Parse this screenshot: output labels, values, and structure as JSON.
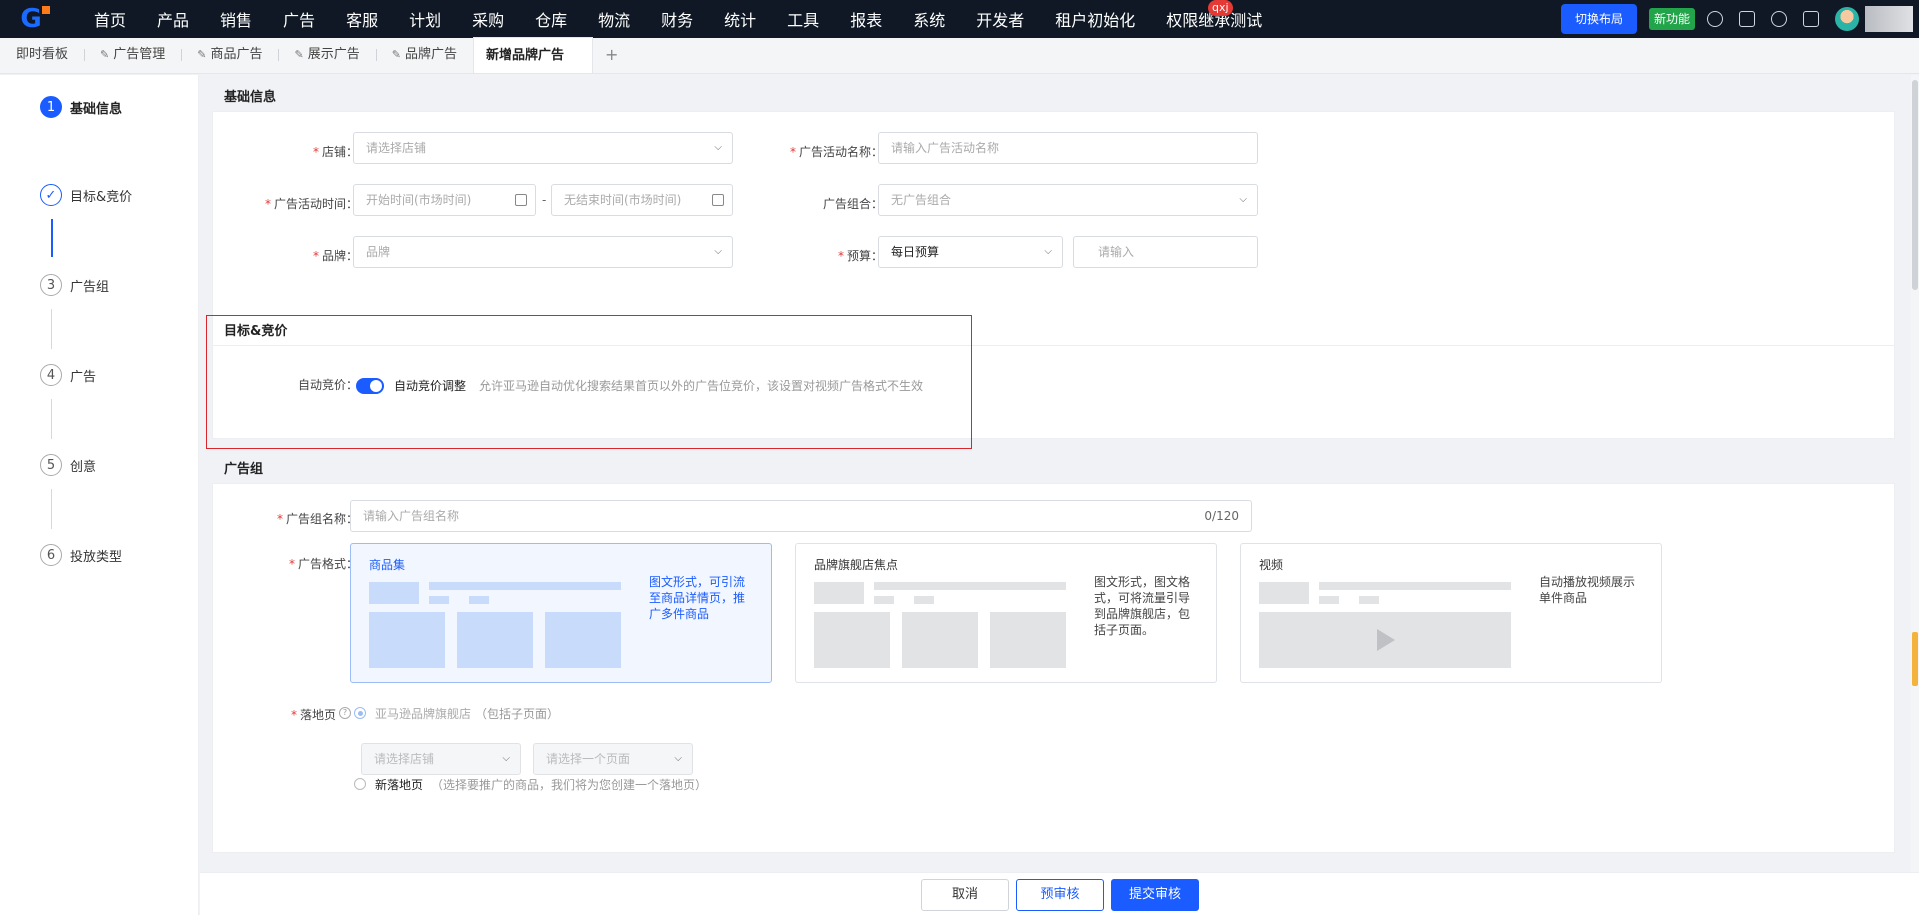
{
  "nav": {
    "menu": [
      "首页",
      "产品",
      "销售",
      "广告",
      "客服",
      "计划",
      "采购",
      "仓库",
      "物流",
      "财务",
      "统计",
      "工具",
      "报表",
      "系统",
      "开发者",
      "租户初始化",
      "权限继承测试"
    ],
    "badge": "qxj",
    "switch_label": "切换布局",
    "new_feature_label": "新功能"
  },
  "tabs": [
    "即时看板",
    "广告管理",
    "商品广告",
    "展示广告",
    "品牌广告",
    "新增品牌广告"
  ],
  "tab_add": "+",
  "steps": [
    {
      "num": "1",
      "label": "基础信息",
      "state": "active"
    },
    {
      "num": "✓",
      "label": "目标&竞价",
      "state": "done"
    },
    {
      "num": "3",
      "label": "广告组",
      "state": "todo"
    },
    {
      "num": "4",
      "label": "广告",
      "state": "todo"
    },
    {
      "num": "5",
      "label": "创意",
      "state": "todo"
    },
    {
      "num": "6",
      "label": "投放类型",
      "state": "todo"
    }
  ],
  "basic": {
    "title": "基础信息",
    "store_label": "店铺：",
    "store_placeholder": "请选择店铺",
    "campaign_name_label": "广告活动名称：",
    "campaign_name_placeholder": "请输入广告活动名称",
    "time_label": "广告活动时间：",
    "start_placeholder": "开始时间(市场时间)",
    "time_sep": "-",
    "end_placeholder": "无结束时间(市场时间)",
    "portfolio_label": "广告组合：",
    "portfolio_value": "无广告组合",
    "brand_label": "品牌：",
    "brand_placeholder": "品牌",
    "budget_label": "预算：",
    "budget_type": "每日预算",
    "budget_placeholder": "请输入"
  },
  "bidding": {
    "title": "目标&竞价",
    "auto_label": "自动竞价：",
    "toggle_text": "自动竞价调整",
    "hint": "允许亚马逊自动优化搜索结果首页以外的广告位竞价，该设置对视频广告格式不生效"
  },
  "adgroup": {
    "title": "广告组",
    "name_label": "广告组名称：",
    "name_placeholder": "请输入广告组名称",
    "name_count": "0/120",
    "format_label": "广告格式：",
    "formats": [
      {
        "name": "商品集",
        "desc": "图文形式，可引流至商品详情页，推广多件商品",
        "selected": true
      },
      {
        "name": "品牌旗舰店焦点",
        "desc": "图文形式，图文格式，可将流量引导到品牌旗舰店，包括子页面。",
        "selected": false
      },
      {
        "name": "视频",
        "desc": "自动播放视频展示单件商品",
        "selected": false
      }
    ],
    "landing_label": "落地页",
    "landing_opt1": "亚马逊品牌旗舰店",
    "landing_opt1_note": "（包括子页面）",
    "landing_store_placeholder": "请选择店铺",
    "landing_page_placeholder": "请选择一个页面",
    "landing_opt2": "新落地页",
    "landing_opt2_note": "（选择要推广的商品，我们将为您创建一个落地页）"
  },
  "actions": {
    "cancel": "取消",
    "pre_review": "预审核",
    "submit": "提交审核"
  },
  "colors": {
    "primary": "#1a5cff",
    "nav_bg": "#0f1824",
    "required": "#e53935",
    "highlight": "#d9262a"
  }
}
